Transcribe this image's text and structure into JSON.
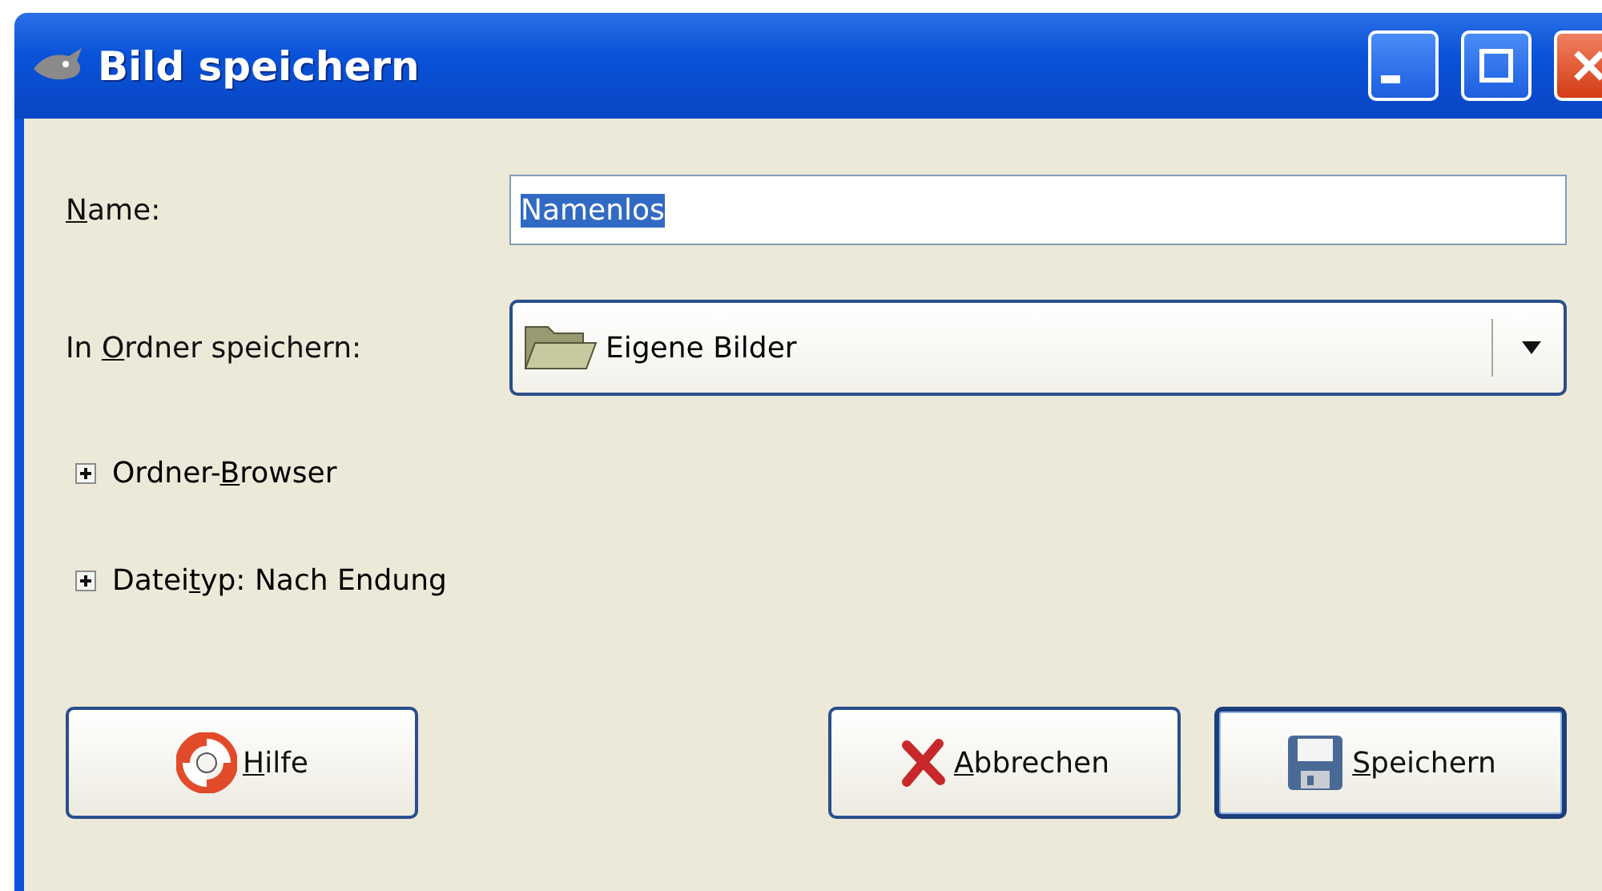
{
  "window": {
    "title": "Bild speichern",
    "controls": [
      {
        "kind": "minimize"
      },
      {
        "kind": "maximize"
      },
      {
        "kind": "close"
      }
    ]
  },
  "name_row": {
    "mnemonic": "N",
    "label_rest": "ame:",
    "value": "Namenlos",
    "text_selected": true
  },
  "folder_row": {
    "label_start": "In ",
    "mnemonic": "O",
    "label_rest": "rdner speichern:",
    "value": "Eigene Bilder"
  },
  "expanders": [
    {
      "label_start": "Ordner-",
      "mnemonic": "B",
      "label_rest": "rowser",
      "expanded": false
    },
    {
      "label_start": "Datei",
      "mnemonic": "t",
      "label_rest": "yp: Nach Endung",
      "expanded": false
    }
  ],
  "buttons": [
    {
      "kind": "help",
      "mnemonic": "H",
      "label_rest": "ilfe",
      "default": false
    },
    {
      "kind": "cancel",
      "mnemonic": "A",
      "label_rest": "bbrechen",
      "default": false
    },
    {
      "kind": "save",
      "mnemonic": "S",
      "label_rest": "peichern",
      "default": true
    }
  ]
}
